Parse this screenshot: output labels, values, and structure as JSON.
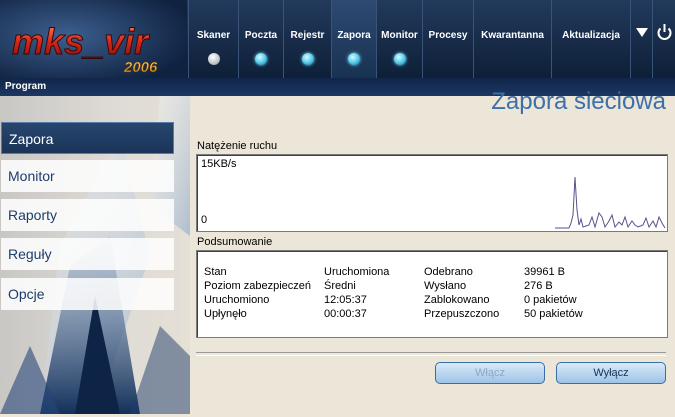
{
  "app": {
    "logo_text": "mks_vir",
    "logo_year": "2006"
  },
  "nav": {
    "tabs": [
      {
        "label": "Skaner",
        "status": "inactive"
      },
      {
        "label": "Poczta",
        "status": "on"
      },
      {
        "label": "Rejestr",
        "status": "on"
      },
      {
        "label": "Zapora",
        "status": "on"
      },
      {
        "label": "Monitor",
        "status": "on"
      },
      {
        "label": "Procesy",
        "status": ""
      },
      {
        "label": "Kwarantanna",
        "status": ""
      },
      {
        "label": "Aktualizacja",
        "status": ""
      }
    ],
    "menu_icon": "chevron-down-icon",
    "power_icon": "power-icon"
  },
  "subbar": {
    "program_label": "Program"
  },
  "page": {
    "title": "Zapora sieciowa"
  },
  "sidebar": {
    "items": [
      {
        "label": "Zapora",
        "active": true
      },
      {
        "label": "Monitor",
        "active": false
      },
      {
        "label": "Raporty",
        "active": false
      },
      {
        "label": "Reguły",
        "active": false
      },
      {
        "label": "Opcje",
        "active": false
      }
    ]
  },
  "traffic": {
    "label": "Natężenie ruchu",
    "max_label": "15KB/s",
    "min_label": "0",
    "line_color": "#5b4f8c"
  },
  "summary": {
    "label": "Podsumowanie",
    "left": [
      {
        "key": "Stan",
        "value": "Uruchomiona"
      },
      {
        "key": "Poziom zabezpieczeń",
        "value": "Średni"
      },
      {
        "key": "Uruchomiono",
        "value": "12:05:37"
      },
      {
        "key": "Upłynęło",
        "value": "00:00:37"
      }
    ],
    "right": [
      {
        "key": "Odebrano",
        "value": "39961 B"
      },
      {
        "key": "Wysłano",
        "value": "276 B"
      },
      {
        "key": "Zablokowano",
        "value": "0 pakietów"
      },
      {
        "key": "Przepuszczono",
        "value": "50 pakietów"
      }
    ]
  },
  "buttons": {
    "enable_label": "Włącz",
    "disable_label": "Wyłącz"
  },
  "colors": {
    "accent": "#3d6fa8",
    "header_bg": "#182c4c",
    "status_on": "#4fc7e8"
  }
}
